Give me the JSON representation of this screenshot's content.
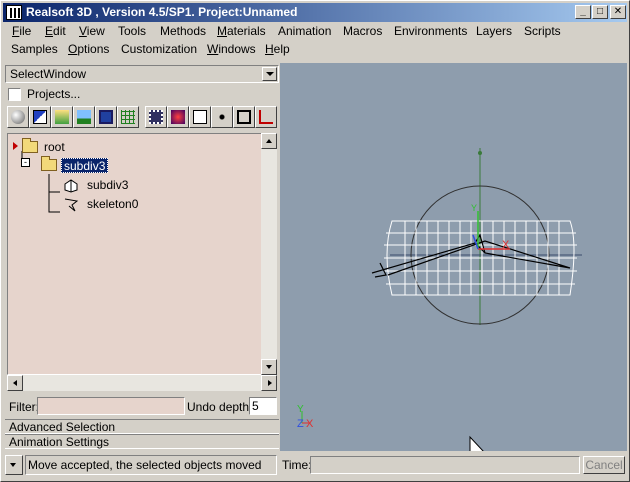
{
  "window": {
    "title": "Realsoft 3D , Version 4.5/SP1. Project:Unnamed",
    "app_icon": "realsoft-app-icon",
    "controls": {
      "minimize": "_",
      "maximize": "□",
      "close": "✕"
    }
  },
  "menu": {
    "row1": [
      {
        "label": "File",
        "u": "F",
        "rest": "ile"
      },
      {
        "label": "Edit",
        "u": "E",
        "rest": "dit"
      },
      {
        "label": "View",
        "u": "V",
        "rest": "iew"
      },
      {
        "label": "Tools",
        "u": "",
        "rest": "Tools"
      },
      {
        "label": "Methods",
        "u": "",
        "rest": "Methods"
      },
      {
        "label": "Materials",
        "u": "M",
        "rest": "aterials"
      },
      {
        "label": "Animation",
        "u": "",
        "rest": "Animation"
      },
      {
        "label": "Macros",
        "u": "",
        "rest": "Macros"
      },
      {
        "label": "Environments",
        "u": "",
        "rest": "Environments"
      },
      {
        "label": "Layers",
        "u": "",
        "rest": "Layers"
      },
      {
        "label": "Scripts",
        "u": "",
        "rest": "Scripts"
      }
    ],
    "row2": [
      {
        "label": "Samples",
        "u": "",
        "rest": "Samples"
      },
      {
        "label": "Options",
        "u": "O",
        "rest": "ptions"
      },
      {
        "label": "Customization",
        "u": "",
        "rest": "Customization"
      },
      {
        "label": "Windows",
        "u": "W",
        "rest": "indows"
      },
      {
        "label": "Help",
        "u": "H",
        "rest": "elp"
      }
    ]
  },
  "select_window": {
    "value": "SelectWindow"
  },
  "projects": {
    "label": "Projects...",
    "checked": false
  },
  "toolbar_icons": [
    "sphere-icon",
    "layers-icon",
    "material-icon",
    "landscape-icon",
    "save-icon",
    "grid-icon",
    "film-icon",
    "render-icon",
    "dice-icon",
    "network-icon",
    "frame-icon",
    "graph-icon"
  ],
  "tree": {
    "nodes": [
      {
        "label": "root",
        "icon": "folder-icon",
        "level": 0,
        "selected": false
      },
      {
        "label": "subdiv3",
        "icon": "folder-icon",
        "level": 1,
        "selected": true
      },
      {
        "label": "subdiv3",
        "icon": "subdiv-object-icon",
        "level": 2,
        "selected": false
      },
      {
        "label": "skeleton0",
        "icon": "skeleton-icon",
        "level": 2,
        "selected": false
      }
    ]
  },
  "filter": {
    "label": "Filter:",
    "value": ""
  },
  "undo": {
    "label": "Undo depth",
    "value": "5"
  },
  "sections": {
    "advanced": "Advanced Selection",
    "animation": "Animation Settings"
  },
  "viewport": {
    "axis_x": "X",
    "axis_y": "Y",
    "axis_z": "Z"
  },
  "status": {
    "message": "Move accepted, the selected objects moved",
    "time_label": "Time:",
    "time_value": "",
    "cancel_label": "Cancel"
  },
  "colors": {
    "title_start": "#0a246a",
    "title_end": "#a6caf0",
    "viewport_bg": "#8e9dad",
    "tree_bg": "#e6d4cc",
    "axis_x": "#e03030",
    "axis_y": "#30c030",
    "axis_z": "#3050e0"
  }
}
